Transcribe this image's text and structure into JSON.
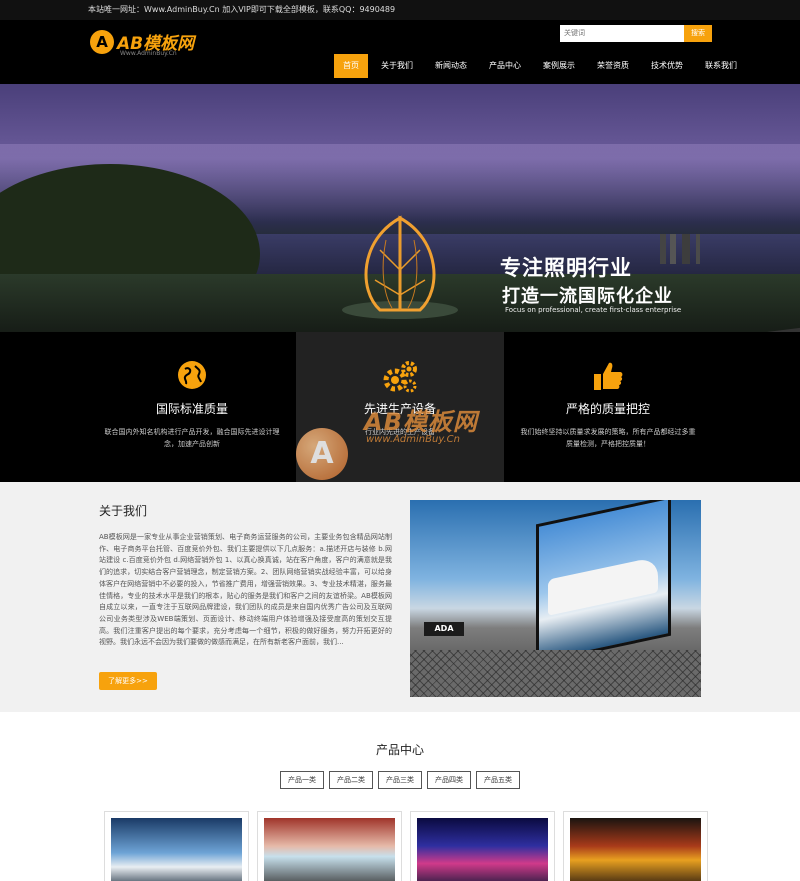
{
  "topbar": {
    "text": "本站唯一网址：Www.AdminBuy.Cn 加入VIP即可下载全部模板，联系QQ：9490489"
  },
  "header": {
    "logo_letter": "A",
    "logo_text": "AB模板网",
    "logo_sub": "Www.AdminBuy.Cn",
    "search_placeholder": "关键词",
    "search_button": "搜索"
  },
  "nav": [
    {
      "label": "首页",
      "active": true
    },
    {
      "label": "关于我们"
    },
    {
      "label": "新闻动态"
    },
    {
      "label": "产品中心"
    },
    {
      "label": "案例展示"
    },
    {
      "label": "荣誉资质"
    },
    {
      "label": "技术优势"
    },
    {
      "label": "联系我们"
    }
  ],
  "banner": {
    "title1": "专注照明行业",
    "title2": "打造一流国际化企业",
    "subtitle": "Focus on professional, create first-class enterprise"
  },
  "features": [
    {
      "icon": "globe-icon",
      "title": "国际标准质量",
      "desc": "联合国内外知名机构进行产品开发，融合国际先进设计理念，加速产品创新"
    },
    {
      "icon": "gears-icon",
      "title": "先进生产设备",
      "desc": "行业内先进的生产设备"
    },
    {
      "icon": "thumbs-up-icon",
      "title": "严格的质量把控",
      "desc": "我们始终坚持以质量求发展的策略，所有产品都经过多重质量检测，严格把控质量！"
    }
  ],
  "watermark": {
    "letter": "A",
    "text": "AB模板网",
    "url": "www.AdminBuy.Cn"
  },
  "about": {
    "title": "关于我们",
    "text": "AB模板网是一家专业从事企业营销策划、电子商务运营服务的公司，主要业务包含精品网站制作、电子商务平台托管、百度竞价外包、我们主要提供以下几点服务：a.描述开店与装修 b.网站建设 c.百度竞价外包 d.网络营销外包 1、以真心换真诚，站在客户角度，客户的满意就是我们的追求，切实结合客户营销理念，制定营销方案。2、团队网络营销实战经验丰富，可以给身体客户在网络营销中不必要的投入，节省推广费用，增强营销效果。3、专业技术精湛，服务最佳情格，专业的技术水平是我们的根本，贴心的服务是我们和客户之间的友谊桥梁。AB模板网自成立以来，一直专注于互联网品牌建设，我们团队的成员是来自国内优秀广告公司及互联网公司业务类型涉及WEB端策划、页面设计、移动终端用户体验增强及接受度高的策划交互提高。我们注重客户提出的每个要求，充分考虑每一个细节，积极的做好服务，努力开拓更好的视野。我们永远不会因为我们要做的做感而满足，在所有新老客户面前，我们...",
    "button": "了解更多>>",
    "image_sign": "ADA"
  },
  "products": {
    "title": "产品中心",
    "tabs": [
      "产品一类",
      "产品二类",
      "产品三类",
      "产品四类",
      "产品五类"
    ]
  },
  "colors": {
    "accent": "#f7a20d",
    "header_bg": "#000000"
  }
}
